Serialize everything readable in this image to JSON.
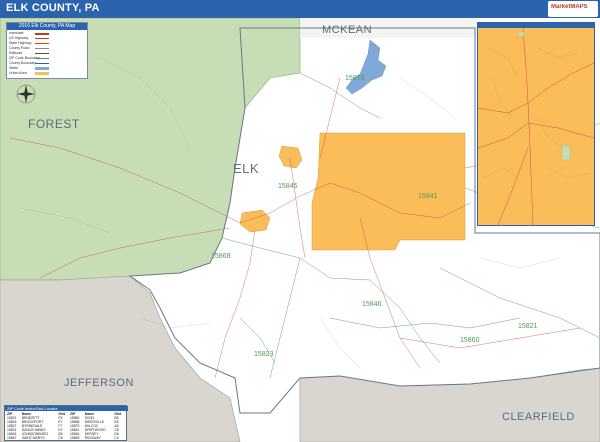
{
  "title": "ELK COUNTY, PA",
  "logo": {
    "text": "MarketMAPS"
  },
  "colors": {
    "title_bar": "#2b63ad",
    "forest_land": "#c7ddb6",
    "neighbor_county": "#d9d6cf",
    "urban_area": "#fbbd5a",
    "water": "#7fa9d6",
    "road": "#c0392b",
    "zip_boundary": "#4c9a53"
  },
  "counties": {
    "mckean": "MCKEAN",
    "forest": "FOREST",
    "elk": "ELK",
    "jefferson": "JEFFERSON",
    "clearfield": "CLEARFIELD"
  },
  "zip_labels": [
    "15870",
    "15845",
    "15841",
    "15868",
    "15846",
    "15823",
    "15860",
    "15821"
  ],
  "compass_icon": "compass-rose-icon",
  "legend": {
    "title": "2016 Elk County, PA Map",
    "rows": [
      {
        "label": "Interstate",
        "color": "#c0392b"
      },
      {
        "label": "US Highway",
        "color": "#c0392b"
      },
      {
        "label": "State Highway",
        "color": "#d35400"
      },
      {
        "label": "County Road",
        "color": "#7f8c8d"
      },
      {
        "label": "Railroad",
        "color": "#555555"
      },
      {
        "label": "ZIP Code Boundary",
        "color": "#4c9a53"
      },
      {
        "label": "County Boundary",
        "color": "#2b63ad"
      },
      {
        "label": "Water",
        "color": "#7fa9d6"
      },
      {
        "label": "Urban Area",
        "color": "#fbbd5a"
      }
    ]
  },
  "index": {
    "title": "ZIP Code Index/Grid Locator",
    "headers": [
      "ZIP",
      "Name",
      "Grid",
      "ZIP",
      "Name",
      "Grid"
    ],
    "rows": [
      [
        "15821",
        "BENEZETT",
        "F8",
        "15860",
        "SIGEL",
        "B8"
      ],
      [
        "15823",
        "BROCKPORT",
        "E7",
        "15868",
        "WEEDVILLE",
        "E8"
      ],
      [
        "15827",
        "BYRNEDALE",
        "F7",
        "15870",
        "WILCOX",
        "A5"
      ],
      [
        "15831",
        "DAGUS MINES",
        "D7",
        "15841",
        "DRIFTWOOD",
        "C8"
      ],
      [
        "15845",
        "JOHNSONBURG",
        "B5",
        "15846",
        "KERSEY",
        "D6"
      ],
      [
        "15857",
        "SAINT MARYS",
        "C6",
        "15853",
        "RIDGWAY",
        "C4"
      ]
    ]
  }
}
